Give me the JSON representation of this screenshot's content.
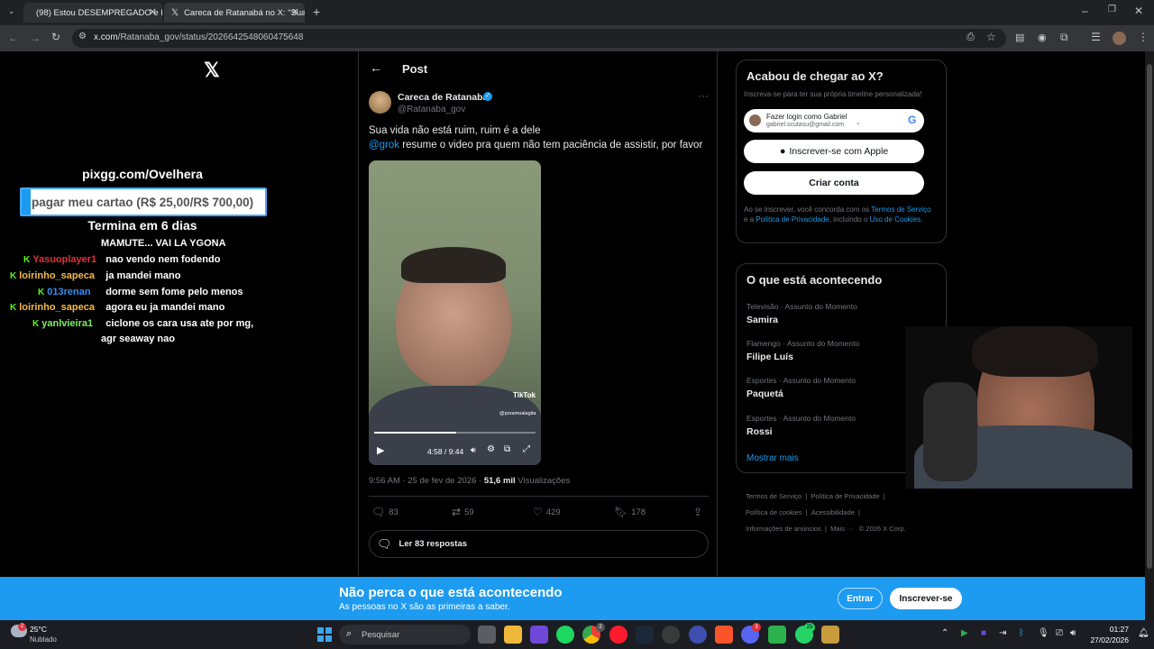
{
  "browser": {
    "tabs": [
      {
        "title": "(98) Estou DESEMPREGADO e h",
        "active": false
      },
      {
        "title": "Careca de Ratanabá no X: \"Sua",
        "active": true
      }
    ],
    "url_host": "x.com",
    "url_path": "/Ratanaba_gov/status/2026642548060475648"
  },
  "overlay": {
    "pix": "pixgg.com/Ovelhera",
    "goal": "pagar meu cartao (R$ 25,00/R$ 700,00)",
    "goal_progress": 0.0357,
    "ends": "Termina em 6 dias",
    "chat": [
      {
        "user": "",
        "message": "MAMUTE... VAI LA YGONA",
        "color": "#ffffff"
      },
      {
        "user": "Yasuoplayer1",
        "message": "nao vendo nem fodendo",
        "color": "#e0323c"
      },
      {
        "user": "loirinho_sapeca",
        "message": "ja mandei mano",
        "color": "#f5b94a"
      },
      {
        "user": "013renan",
        "message": "dorme sem fome pelo menos",
        "color": "#3a8cf0"
      },
      {
        "user": "loirinho_sapeca",
        "message": "agora eu ja mandei mano",
        "color": "#f5b94a"
      },
      {
        "user": "yanlvieira1",
        "message": "ciclone os cara usa ate por mg,",
        "message2": "agr seaway nao",
        "color": "#7df062"
      }
    ]
  },
  "post": {
    "header_title": "Post",
    "author_name": "Careca de Ratanabá",
    "author_handle": "@Ratanaba_gov",
    "text_line1": "Sua vida não está ruim, ruim é a dele",
    "mention": "@grok",
    "text_line2": " resume o video pra quem não tem paciência de assistir, por favor",
    "video_time": "4:58 / 9:44",
    "video_progress": 0.51,
    "tiktok_label": "TikTok",
    "tiktok_user": "@poramoalagita",
    "timestamp": "9:56 AM · 25 de fev de 2026 · ",
    "views": "51,6 mil",
    "views_label": " Visualizações",
    "replies": "83",
    "reposts": "59",
    "likes": "429",
    "bookmarks": "178",
    "read_replies": "Ler 83 respostas"
  },
  "signup": {
    "title": "Acabou de chegar ao X?",
    "subtitle": "Inscreva-se para ter sua própria timeline personalizada!",
    "google_login": "Fazer login como Gabriel",
    "google_email": "gabriel.scutasu@gmail.com",
    "apple": "Inscrever-se com Apple",
    "create": "Criar conta",
    "terms_pre": "Ao se inscrever, você concorda com os ",
    "terms_link1": "Termos de Serviço",
    "terms_mid": " e a ",
    "terms_link2": "Política de Privacidade",
    "terms_mid2": ", incluindo o ",
    "terms_link3": "Uso de Cookies",
    "terms_end": "."
  },
  "trends": {
    "title": "O que está acontecendo",
    "items": [
      {
        "category": "Televisão · Assunto do Momento",
        "name": "Samira"
      },
      {
        "category": "Flamengo · Assunto do Momento",
        "name": "Filipe Luís"
      },
      {
        "category": "Esportes · Assunto do Momento",
        "name": "Paquetá"
      },
      {
        "category": "Esportes · Assunto do Momento",
        "name": "Rossi"
      }
    ],
    "show_more": "Mostrar mais"
  },
  "footer": [
    "Termos de Serviço",
    "Política de Privacidade",
    "Política de cookies",
    "Acessibilidade",
    "Informações de anúncios",
    "Mais ···",
    "© 2026 X Corp."
  ],
  "banner": {
    "title": "Não perca o que está acontecendo",
    "subtitle": "As pessoas no X são as primeiras a saber.",
    "login": "Entrar",
    "signup": "Inscrever-se"
  },
  "taskbar": {
    "weather_temp": "25°C",
    "weather_desc": "Nublado",
    "weather_badge": "2",
    "search": "Pesquisar",
    "time": "01:27",
    "date": "27/02/2026",
    "badges": [
      "2",
      "3",
      "25"
    ]
  },
  "colors": {
    "accent": "#1d9bf0",
    "kick": "#53fc18",
    "banner": "#1d9bf0"
  }
}
